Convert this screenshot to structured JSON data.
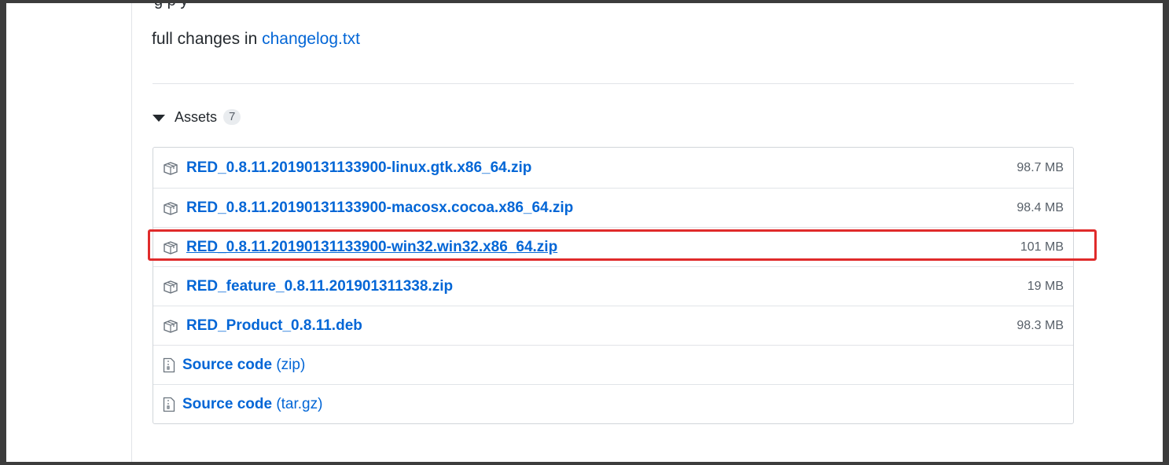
{
  "release": {
    "cut_off_text": "                    g         p              y",
    "changelog_prefix": "full changes in ",
    "changelog_link": "changelog.txt"
  },
  "assets": {
    "label": "Assets",
    "count": "7",
    "files": [
      {
        "name": "RED_0.8.11.20190131133900-linux.gtk.x86_64.zip",
        "size": "98.7 MB"
      },
      {
        "name": "RED_0.8.11.20190131133900-macosx.cocoa.x86_64.zip",
        "size": "98.4 MB"
      },
      {
        "name": "RED_0.8.11.20190131133900-win32.win32.x86_64.zip",
        "size": "101 MB"
      },
      {
        "name": "RED_feature_0.8.11.201901311338.zip",
        "size": "19 MB"
      },
      {
        "name": "RED_Product_0.8.11.deb",
        "size": "98.3 MB"
      }
    ],
    "source": [
      {
        "label": "Source code",
        "ext": "(zip)"
      },
      {
        "label": "Source code",
        "ext": "(tar.gz)"
      }
    ]
  },
  "colors": {
    "link": "#0366d6",
    "highlight": "#e02b2b"
  }
}
